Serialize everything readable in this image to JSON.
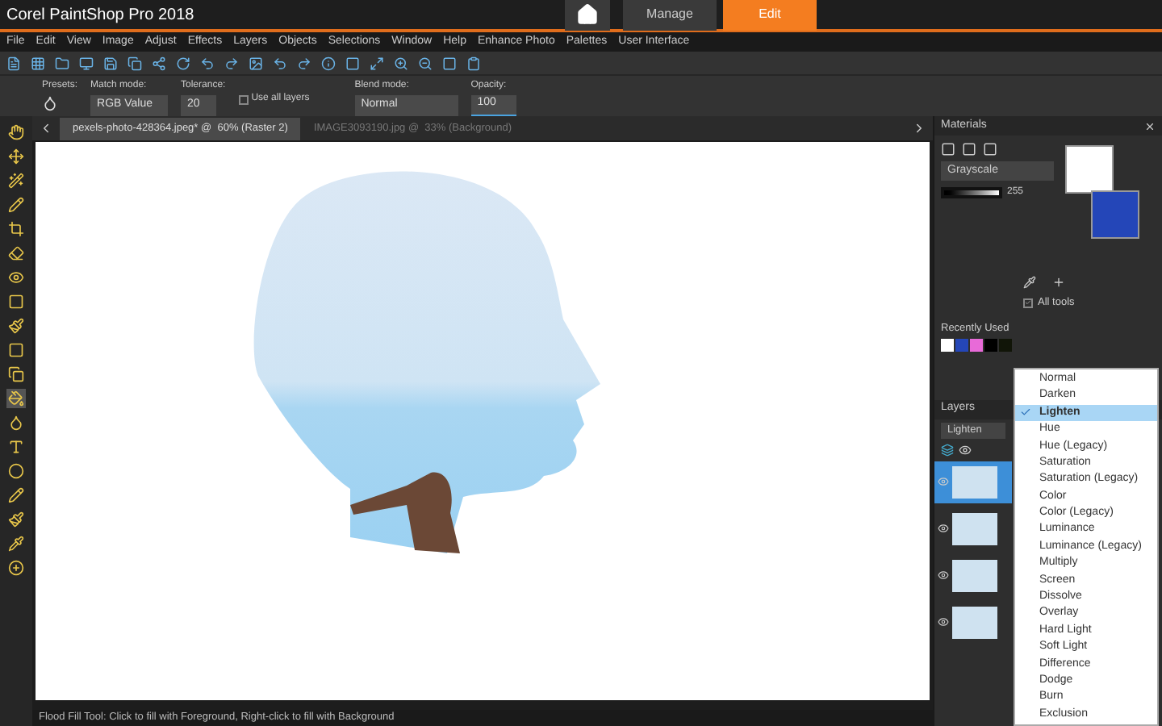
{
  "window": {
    "title": "Corel PaintShop Pro 2018"
  },
  "workspace_tabs": [
    {
      "label": "Manage",
      "selected": false
    },
    {
      "label": "Edit",
      "selected": true
    }
  ],
  "menu": [
    "File",
    "Edit",
    "View",
    "Image",
    "Adjust",
    "Effects",
    "Layers",
    "Objects",
    "Selections",
    "Window",
    "Help",
    "Enhance Photo",
    "Palettes",
    "User Interface"
  ],
  "tool_options": {
    "presets_label": "Presets:",
    "match_mode": {
      "label": "Match mode:",
      "value": "RGB Value"
    },
    "tolerance": {
      "label": "Tolerance:",
      "value": "20"
    },
    "use_all_layers": {
      "label": "Use all layers",
      "checked": false
    },
    "blend_mode": {
      "label": "Blend mode:",
      "value": "Normal"
    },
    "opacity": {
      "label": "Opacity:",
      "value": "100"
    }
  },
  "document_tabs": [
    {
      "label": "pexels-photo-428364.jpeg* @  60% (Raster 2)",
      "selected": true
    },
    {
      "label": "IMAGE3093190.jpg @  33% (Background)",
      "selected": false
    }
  ],
  "tools": [
    {
      "selected": false
    },
    {
      "selected": false
    },
    {
      "selected": false
    },
    {
      "selected": false
    },
    {
      "selected": false
    },
    {
      "selected": false
    },
    {
      "selected": false
    },
    {
      "selected": false
    },
    {
      "selected": false
    },
    {
      "selected": false
    },
    {
      "selected": false
    },
    {
      "selected": true
    },
    {
      "selected": false
    },
    {
      "selected": false
    },
    {
      "selected": false
    },
    {
      "selected": false
    },
    {
      "selected": false
    },
    {
      "selected": false
    },
    {
      "selected": false
    }
  ],
  "materials": {
    "title": "Materials",
    "palette": "Grayscale",
    "slider": {
      "level": 1,
      "reading": "255"
    },
    "foreground": {
      "color": "#ffffff"
    },
    "background": {
      "color": "#2446b8"
    },
    "all_tools": {
      "label": "All tools",
      "checked": true
    },
    "recent_label": "Recently Used",
    "recent": [
      {
        "color": "#ffffff"
      },
      {
        "color": "#2446b8"
      },
      {
        "color": "#e86ad8"
      },
      {
        "color": "#000000"
      },
      {
        "color": "#111508"
      }
    ]
  },
  "layers": {
    "title": "Layers",
    "blend": "Lighten",
    "items": [
      {
        "selected": true
      },
      {
        "selected": false
      },
      {
        "selected": false
      },
      {
        "selected": false
      }
    ]
  },
  "blend_menu": [
    {
      "label": "Normal",
      "selected": false
    },
    {
      "label": "Darken",
      "selected": false
    },
    {
      "label": "Lighten",
      "selected": true
    },
    {
      "label": "Hue",
      "selected": false
    },
    {
      "label": "Hue (Legacy)",
      "selected": false
    },
    {
      "label": "Saturation",
      "selected": false
    },
    {
      "label": "Saturation (Legacy)",
      "selected": false
    },
    {
      "label": "Color",
      "selected": false
    },
    {
      "label": "Color (Legacy)",
      "selected": false
    },
    {
      "label": "Luminance",
      "selected": false
    },
    {
      "label": "Luminance (Legacy)",
      "selected": false
    },
    {
      "label": "Multiply",
      "selected": false
    },
    {
      "label": "Screen",
      "selected": false
    },
    {
      "label": "Dissolve",
      "selected": false
    },
    {
      "label": "Overlay",
      "selected": false
    },
    {
      "label": "Hard Light",
      "selected": false
    },
    {
      "label": "Soft Light",
      "selected": false
    },
    {
      "label": "Difference",
      "selected": false
    },
    {
      "label": "Dodge",
      "selected": false
    },
    {
      "label": "Burn",
      "selected": false
    },
    {
      "label": "Exclusion",
      "selected": false
    }
  ],
  "status_bar": "Flood Fill Tool: Click to fill with Foreground, Right-click to fill with Background"
}
